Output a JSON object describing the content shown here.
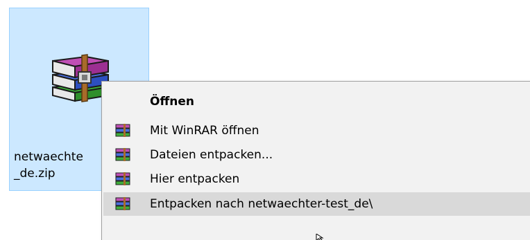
{
  "file": {
    "name_line1": "netwaechte",
    "name_line2": "_de.zip",
    "icon": "winrar-archive-icon"
  },
  "context_menu": {
    "items": [
      {
        "label": "Öffnen",
        "bold": true,
        "icon": ""
      },
      {
        "label": "Mit WinRAR öffnen",
        "bold": false,
        "icon": "winrar-icon"
      },
      {
        "label": "Dateien entpacken...",
        "bold": false,
        "icon": "winrar-icon"
      },
      {
        "label": "Hier entpacken",
        "bold": false,
        "icon": "winrar-icon"
      },
      {
        "label": "Entpacken nach netwaechter-test_de\\",
        "bold": false,
        "icon": "winrar-icon",
        "highlighted": true
      }
    ]
  },
  "colors": {
    "selection_fill": "#cce8ff",
    "selection_border": "#99d1ff",
    "menu_background": "#f2f2f2",
    "menu_hover": "#d9d9d9"
  }
}
